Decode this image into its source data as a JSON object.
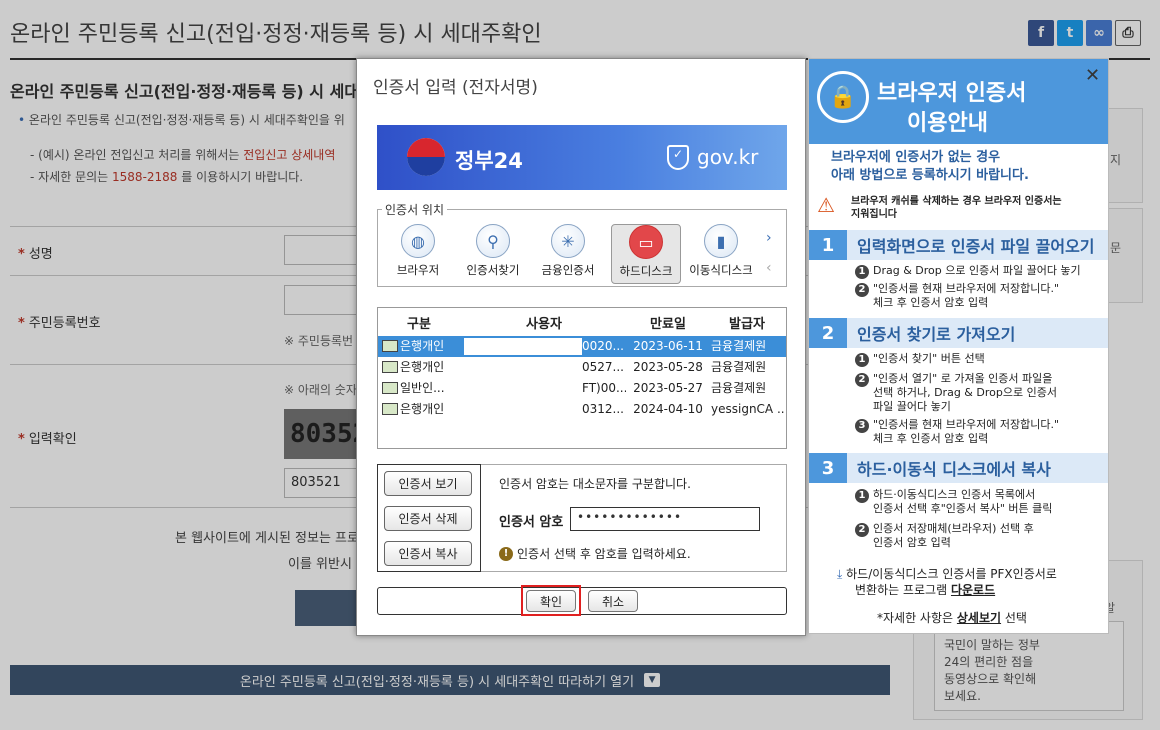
{
  "page": {
    "title": "온라인 주민등록 신고(전입·정정·재등록 등) 시 세대주확인",
    "subtitle": "온라인 주민등록 신고(전입·정정·재등록 등) 시 세대주",
    "bullet": "온라인 주민등록 신고(전입·정정·재등록 등) 시 세대주확인을 위",
    "note1_a": "- (예시) 온라인 전입신고 처리를 위해서는",
    "note1_link": "전입신고 상세내역",
    "note2_a": "- 자세한 문의는",
    "note2_phone": "1588-2188",
    "note2_b": "를 이용하시기 바랍니다.",
    "label_name": "성명",
    "label_rrn": "주민등록번호",
    "rrn_hint": "※ 주민등록번",
    "captcha_hint": "※ 아래의 숫자",
    "label_captcha": "입력확인",
    "captcha_image_text": "80352",
    "captcha_value": "803521",
    "disclaimer1": "본 웹사이트에 게시된 정보는 프로",
    "disclaimer2": "이를 위반시",
    "bottom_bar": "온라인 주민등록 신고(전입·정정·재등록 등) 시 세대주확인 따라하기 열기",
    "side_text1": "국민이 말하는 정부",
    "side_text2": "24의 편리한 점을",
    "side_text3": "동영상으로 확인해",
    "side_text4": "보세요.",
    "side_frag1": "지",
    "side_frag2": "문",
    "side_frag3": "알"
  },
  "share_icons": [
    "facebook-icon",
    "twitter-icon",
    "link-icon",
    "print-icon"
  ],
  "dialog": {
    "title": "인증서 입력 (전자서명)",
    "banner_brand": "정부24",
    "banner_domain": "gov.kr",
    "location_legend": "인증서 위치",
    "locations": [
      {
        "label": "브라우저",
        "icon": "globe-icon"
      },
      {
        "label": "인증서찾기",
        "icon": "magnifier-icon"
      },
      {
        "label": "금융인증서",
        "icon": "financial-cert-icon"
      },
      {
        "label": "하드디스크",
        "icon": "harddisk-icon",
        "selected": true
      },
      {
        "label": "이동식디스크",
        "icon": "usb-icon"
      }
    ],
    "columns": [
      "구분",
      "사용자",
      "만료일",
      "발급자"
    ],
    "rows": [
      {
        "type": "은행개인",
        "user": "0020...",
        "expiry": "2023-06-11",
        "issuer": "금융결제원",
        "selected": true
      },
      {
        "type": "은행개인",
        "user": "0527...",
        "expiry": "2023-05-28",
        "issuer": "금융결제원"
      },
      {
        "type": "일반인...",
        "user": "FT)00...",
        "expiry": "2023-05-27",
        "issuer": "금융결제원"
      },
      {
        "type": "은행개인",
        "user": "0312...",
        "expiry": "2024-04-10",
        "issuer": "yessignCA ..."
      }
    ],
    "btn_view": "인증서 보기",
    "btn_delete": "인증서 삭제",
    "btn_copy": "인증서 복사",
    "case_notice": "인증서 암호는 대소문자를 구분합니다.",
    "pw_label": "인증서 암호",
    "pw_value": "•••••••••••••",
    "hint": "인증서 선택 후 암호를 입력하세요.",
    "ok": "확인",
    "cancel": "취소"
  },
  "guide": {
    "title1": "브라우저 인증서",
    "title2": "이용안내",
    "intro1": "브라우저에 인증서가 없는 경우",
    "intro2": "아래 방법으로 등록하시기 바랍니다.",
    "warn1": "브라우저 캐쉬를 삭제하는 경우 브라우저 인증서는",
    "warn2": "지워집니다",
    "sections": [
      {
        "num": "1",
        "title": "입력화면으로 인증서 파일 끌어오기"
      },
      {
        "num": "2",
        "title": "인증서 찾기로 가져오기"
      },
      {
        "num": "3",
        "title": "하드·이동식 디스크에서 복사"
      }
    ],
    "s1_l1": "Drag & Drop 으로 인증서 파일 끌어다 놓기",
    "s1_l2a": "\"인증서를 현재 브라우저에 저장합니다.\"",
    "s1_l2b": "체크 후 인증서 암호 입력",
    "s2_l1": "\"인증서 찾기\" 버튼 선택",
    "s2_l2a": "\"인증서 열기\" 로 가져올 인증서 파일을",
    "s2_l2b": "선택 하거나, Drag & Drop으로 인증서",
    "s2_l2c": "파일 끌어다 놓기",
    "s2_l3a": "\"인증서를 현재 브라우저에 저장합니다.\"",
    "s2_l3b": "체크 후 인증서 암호 입력",
    "s3_l1a": "하드·이동식디스크 인증서 목록에서",
    "s3_l1b": "인증서 선택 후\"인증서 복사\" 버튼 클릭",
    "s3_l2a": "인증서 저장매체(브라우저) 선택 후",
    "s3_l2b": "인증서 암호 입력",
    "pfx1": "하드/이동식디스크 인증서를 PFX인증서로",
    "pfx2": "변환하는 프로그램",
    "pfx_link": "다운로드",
    "detail_a": "*자세한 사항은",
    "detail_link": "상세보기",
    "detail_b": "선택"
  }
}
